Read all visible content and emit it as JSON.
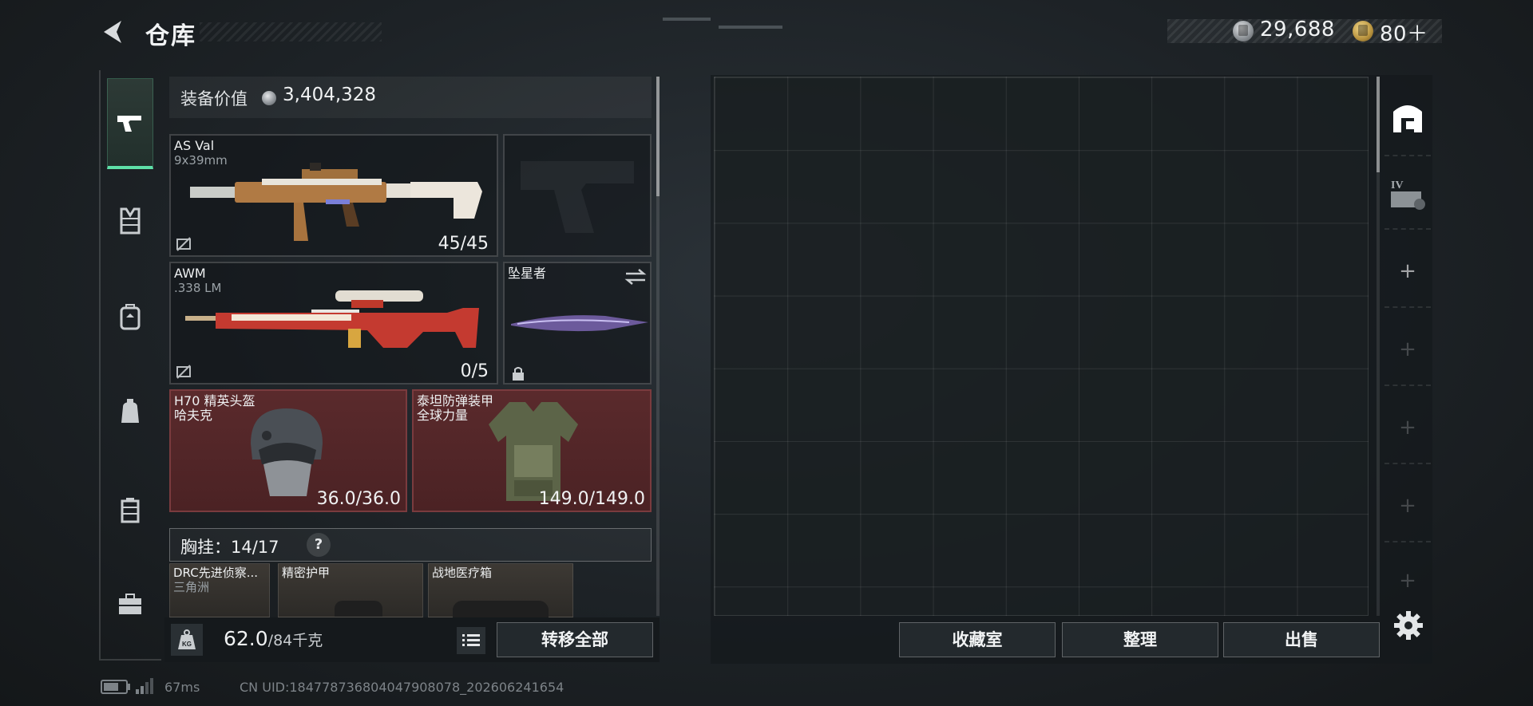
{
  "header": {
    "title": "仓库",
    "currency_silver": "29,688",
    "currency_gold": "80＋"
  },
  "equipment": {
    "value_label": "装备价值",
    "value": "3,404,328",
    "weapon1": {
      "name": "AS Val",
      "caliber": "9x39mm",
      "ammo": "45/45"
    },
    "weapon2": {
      "name": "AWM",
      "caliber": ".338 LM",
      "ammo": "0/5"
    },
    "melee": {
      "name": "坠星者"
    },
    "helmet": {
      "name": "H70 精英头盔",
      "brand": "哈夫克",
      "durability": "36.0/36.0"
    },
    "armor": {
      "name": "泰坦防弹装甲",
      "brand": "全球力量",
      "durability": "149.0/149.0"
    },
    "chest_rig": {
      "label": "胸挂：",
      "capacity": "14/17",
      "help": "?"
    },
    "chest_items": [
      {
        "name": "DRC先进侦察...",
        "sub": "三角洲"
      },
      {
        "name": "精密护甲",
        "sub": ""
      },
      {
        "name": "战地医疗箱",
        "sub": ""
      }
    ]
  },
  "weight": {
    "current": "62.0",
    "max": "/84千克",
    "kg_icon_text": "KG"
  },
  "buttons": {
    "transfer_all": "转移全部",
    "collection": "收藏室",
    "organize": "整理",
    "sell": "出售"
  },
  "side_tabs": {
    "tab2_label": "IV"
  },
  "status": {
    "ping": "67ms",
    "uid": "CN UID:1847787368040479080​78_202606241654"
  },
  "colors": {
    "accent_green": "#5ee0a8",
    "rare_red": "#5a2a2c"
  }
}
